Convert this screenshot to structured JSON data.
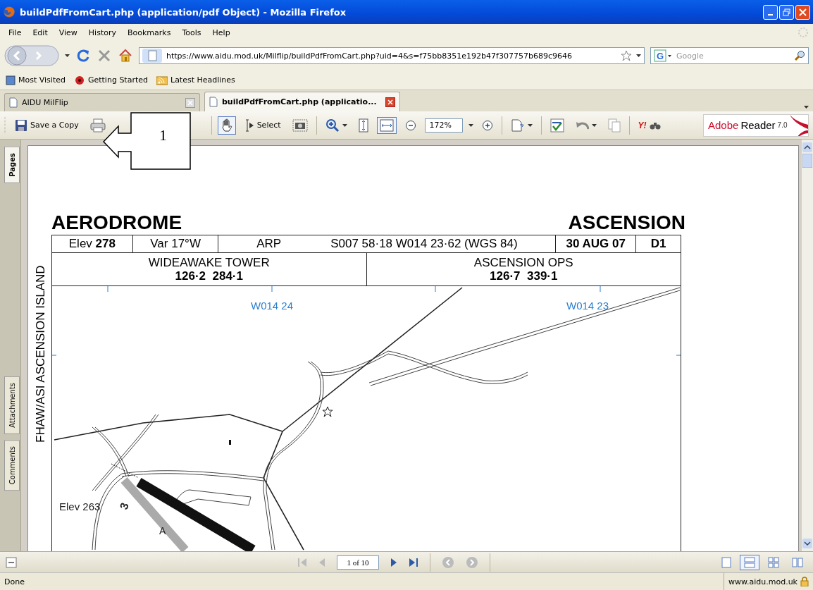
{
  "window": {
    "title": "buildPdfFromCart.php (application/pdf Object) - Mozilla Firefox"
  },
  "menu": [
    "File",
    "Edit",
    "View",
    "History",
    "Bookmarks",
    "Tools",
    "Help"
  ],
  "nav": {
    "url": "https://www.aidu.mod.uk/Milflip/buildPdfFromCart.php?uid=4&s=f75bb8351e192b47f307757b689c9646",
    "search_placeholder": "Google",
    "search_engine": "G"
  },
  "bookmarks": [
    "Most Visited",
    "Getting Started",
    "Latest Headlines"
  ],
  "tabs": [
    {
      "label": "AIDU MilFlip",
      "selected": false
    },
    {
      "label": "buildPdfFromCart.php (applicatio...",
      "selected": true
    }
  ],
  "reader_toolbar": {
    "save_label": "Save a Copy",
    "zoom": "172%",
    "yahoo_label": "Y!",
    "logo_brand": "Adobe",
    "logo_product": "Reader",
    "logo_version": "7.0",
    "tools": [
      {
        "kind": "hand",
        "selected": true
      },
      {
        "kind": "select",
        "label": "Select",
        "selected": false
      }
    ],
    "fit_buttons": [
      {
        "kind": "fit-height",
        "selected": false
      },
      {
        "kind": "fit-width",
        "selected": true
      }
    ]
  },
  "callout": {
    "label": "1"
  },
  "side_tabs": [
    {
      "label": "Pages",
      "selected": true
    },
    {
      "label": "Attachments",
      "selected": false
    },
    {
      "label": "Comments",
      "selected": false
    }
  ],
  "document": {
    "title_left": "AERODROME",
    "title_right": "ASCENSION",
    "side_label": "FHAW/ASI ASCENSION ISLAND",
    "info_cells": [
      {
        "text": "Elev **278**",
        "bold": false
      },
      {
        "text": "Var 17°W",
        "bold": false
      },
      {
        "text": "ARP",
        "detail": "S007 58·18 W014 23·62 (WGS 84)",
        "bold": false
      },
      {
        "text": "30 AUG 07",
        "bold": true
      },
      {
        "text": "D1",
        "bold": true
      }
    ],
    "frequencies": [
      {
        "name": "WIDEAWAKE TOWER",
        "values": "126·2  284·1"
      },
      {
        "name": "ASCENSION OPS",
        "values": "126·7  339·1"
      }
    ],
    "grid_labels": [
      "W014 24",
      "W014 23"
    ],
    "map_labels": [
      "Elev 263",
      "A",
      "3"
    ]
  },
  "page_nav": {
    "page": "1 of 10",
    "layouts": [
      {
        "kind": "single",
        "selected": false
      },
      {
        "kind": "continuous",
        "selected": true
      },
      {
        "kind": "continuous-facing",
        "selected": false
      },
      {
        "kind": "facing",
        "selected": false
      }
    ]
  },
  "status": {
    "text": "Done",
    "host": "www.aidu.mod.uk"
  }
}
